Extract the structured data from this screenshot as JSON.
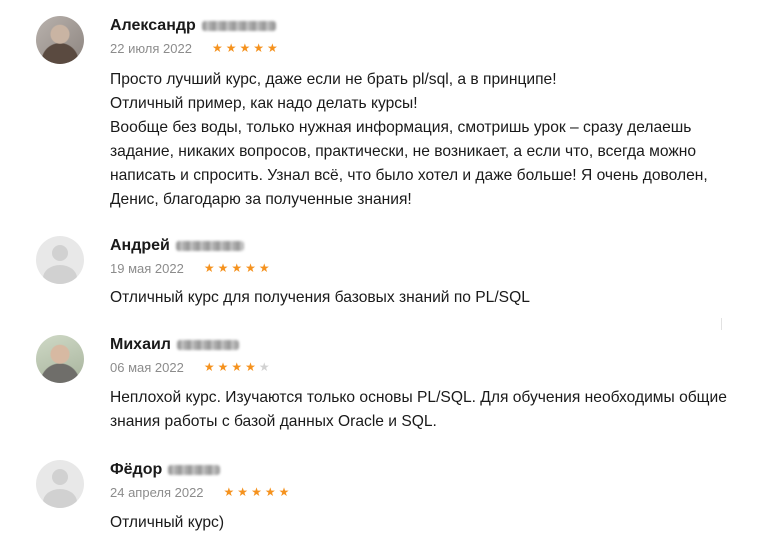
{
  "reviews": [
    {
      "first_name": "Александр",
      "date": "22 июля 2022",
      "rating": 5,
      "paragraphs": [
        "Просто лучший курс, даже если не брать pl/sql, а в принципе!",
        "Отличный пример, как надо делать курсы!",
        "Вообще без воды, только нужная информация, смотришь урок – сразу делаешь",
        "задание, никаких вопросов, практически, не возникает, а если что, всегда можно",
        "написать и спросить. Узнал всё, что было хотел и даже больше! Я очень доволен,",
        "Денис, благодарю за полученные знания!"
      ]
    },
    {
      "first_name": "Андрей",
      "date": "19 мая 2022",
      "rating": 5,
      "paragraphs": [
        "Отличный курс для получения базовых знаний по PL/SQL"
      ]
    },
    {
      "first_name": "Михаил",
      "date": "06 мая 2022",
      "rating": 4,
      "paragraphs": [
        "Неплохой курс. Изучаются только основы PL/SQL. Для обучения необходимы общие",
        "знания работы с базой данных Oracle и SQL."
      ]
    },
    {
      "first_name": "Фёдор",
      "date": "24 апреля 2022",
      "rating": 5,
      "paragraphs": [
        "Отличный курс)"
      ]
    }
  ],
  "icons": {
    "star_filled": "★",
    "star_empty": "★"
  },
  "colors": {
    "star_active": "#f5921e",
    "star_inactive": "#d2d2d2",
    "date": "#8c8c8c"
  }
}
